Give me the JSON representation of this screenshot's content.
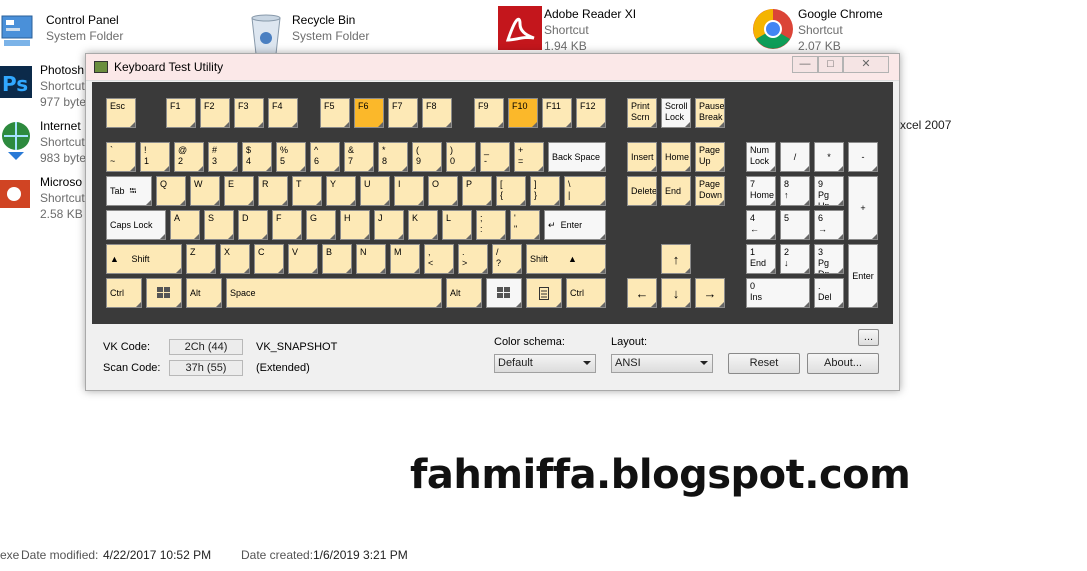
{
  "desktop": {
    "icons": [
      {
        "name": "Control Panel",
        "sub": "System Folder",
        "sub2": ""
      },
      {
        "name": "Recycle Bin",
        "sub": "System Folder",
        "sub2": ""
      },
      {
        "name": "Adobe Reader XI",
        "sub": "Shortcut",
        "sub2": "1.94 KB"
      },
      {
        "name": "Google Chrome",
        "sub": "Shortcut",
        "sub2": "2.07 KB"
      },
      {
        "name": "Photosh",
        "sub": "Shortcut",
        "sub2": "977 byte"
      },
      {
        "name": "Internet",
        "sub": "Shortcut",
        "sub2": "983 byte"
      },
      {
        "name": "Microso",
        "sub": "Shortcut",
        "sub2": "2.58 KB"
      }
    ],
    "partial_right": "xcel 2007"
  },
  "window": {
    "title": "Keyboard Test Utility",
    "min": "—",
    "max": "□",
    "close": "✕"
  },
  "keys": {
    "esc": "Esc",
    "f1": "F1",
    "f2": "F2",
    "f3": "F3",
    "f4": "F4",
    "f5": "F5",
    "f6": "F6",
    "f7": "F7",
    "f8": "F8",
    "f9": "F9",
    "f10": "F10",
    "f11": "F11",
    "f12": "F12",
    "prt1": "Print",
    "prt2": "Scrn",
    "scr1": "Scroll",
    "scr2": "Lock",
    "pau1": "Pause",
    "pau2": "Break",
    "n1": [
      "`",
      "~"
    ],
    "n2": [
      "!",
      "1"
    ],
    "n3": [
      "@",
      "2"
    ],
    "n4": [
      "#",
      "3"
    ],
    "n5": [
      "$",
      "4"
    ],
    "n6": [
      "%",
      "5"
    ],
    "n7": [
      "^",
      "6"
    ],
    "n8": [
      "&",
      "7"
    ],
    "n9": [
      "*",
      "8"
    ],
    "n10": [
      "(",
      "9"
    ],
    "n11": [
      ")",
      "0"
    ],
    "n12": [
      "_",
      "-"
    ],
    "n13": [
      "+",
      "="
    ],
    "bksp": "Back Space",
    "ins": "Insert",
    "home": "Home",
    "pgup1": "Page",
    "pgup2": "Up",
    "numlk1": "Num",
    "numlk2": "Lock",
    "ndiv": "/",
    "nmul": "*",
    "nsub": "-",
    "tab": "Tab",
    "tabsym": "⭾",
    "q": "Q",
    "w": "W",
    "e": "E",
    "r": "R",
    "t": "T",
    "y": "Y",
    "u": "U",
    "i": "I",
    "o": "O",
    "p": "P",
    "lb": [
      "[",
      "{"
    ],
    "rb": [
      "]",
      "}"
    ],
    "bs": [
      "\\",
      "|"
    ],
    "del": "Delete",
    "end": "End",
    "pgdn1": "Page",
    "pgdn2": "Down",
    "n7a": "7",
    "n7b": "Home",
    "n8a": "8",
    "n8b": "↑",
    "n9a": "9",
    "n9b": "Pg Up",
    "nadd": "+",
    "caps": "Caps Lock",
    "a": "A",
    "s": "S",
    "d": "D",
    "f": "F",
    "g": "G",
    "h": "H",
    "j": "J",
    "k": "K",
    "l": "L",
    "sc": [
      ";",
      ":"
    ],
    "qt": [
      "'",
      "\""
    ],
    "enter": "Enter",
    "entsym": "↵",
    "n4a": "4",
    "n4b": "←",
    "n5a": "5",
    "n6a": "6",
    "n6b": "→",
    "shift": "Shift",
    "shsym": "▲",
    "z": "Z",
    "x": "X",
    "c": "C",
    "v": "V",
    "b": "B",
    "n": "N",
    "m": "M",
    "cm": [
      ",",
      "<"
    ],
    "pd": [
      ".",
      ">"
    ],
    "sl": [
      "/",
      "?"
    ],
    "up": "↑",
    "n1a": "1",
    "n1b": "End",
    "n2a": "2",
    "n2b": "↓",
    "n3a": "3",
    "n3b": "Pg Dn",
    "nent": "Enter",
    "ctrl": "Ctrl",
    "alt": "Alt",
    "space": "Space",
    "left": "←",
    "down": "↓",
    "right": "→",
    "n0a": "0",
    "n0b": "Ins",
    "ndota": ".",
    "ndotb": "Del"
  },
  "info": {
    "vk_label": "VK Code:",
    "vk_value": "2Ch (44)",
    "vk_name": "VK_SNAPSHOT",
    "scan_label": "Scan Code:",
    "scan_value": "37h (55)",
    "scan_ext": "(Extended)",
    "color_label": "Color schema:",
    "color_value": "Default",
    "layout_label": "Layout:",
    "layout_value": "ANSI",
    "more": "...",
    "reset": "Reset",
    "about": "About..."
  },
  "brand": "fahmiffa.blogspot.com",
  "status": {
    "left": "exe",
    "modified_label": "Date modified:",
    "modified": "4/22/2017 10:52 PM",
    "created_label": "Date created:",
    "created": "1/6/2019 3:21 PM"
  }
}
